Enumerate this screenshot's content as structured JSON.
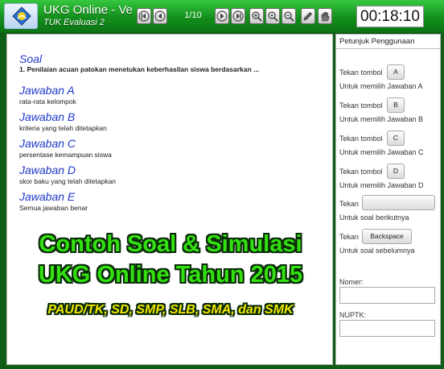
{
  "window": {
    "title": "UKG Online - Ver. (",
    "subtitle": "TUK Evaluasi 2",
    "page_indicator": "1/10",
    "timer": "00:18:10"
  },
  "toolbar": {
    "icons": [
      "first-page-icon",
      "prev-page-icon",
      "next-page-icon",
      "last-page-icon",
      "zoom-in-icon",
      "zoom-reset-icon",
      "zoom-out-icon",
      "edit-icon",
      "hand-icon"
    ]
  },
  "question": {
    "label": "Soal",
    "text": "1. Penilaian acuan patokan menetukan keberhasilan siswa berdasarkan ...",
    "answers": [
      {
        "label": "Jawaban A",
        "text": "rata-rata kelompok"
      },
      {
        "label": "Jawaban B",
        "text": "kriteria yang telah ditetapkan"
      },
      {
        "label": "Jawaban C",
        "text": "persentase kemampuan siswa"
      },
      {
        "label": "Jawaban D",
        "text": "skor baku yang telah ditetapkan"
      },
      {
        "label": "Jawaban E",
        "text": "Semua jawaban benar"
      }
    ]
  },
  "overlay": {
    "line1": "Contoh Soal & Simulasi",
    "line2": "UKG Online Tahun 2015",
    "line3": "PAUD/TK, SD, SMP, SLB, SMA, dan SMK"
  },
  "instructions": {
    "title": "Petunjuk Penggunaan",
    "press": "Tekan tombol",
    "press_short": "Tekan",
    "keys": [
      {
        "key": "A",
        "desc": "Untuk memilih Jawaban A"
      },
      {
        "key": "B",
        "desc": "Untuk memilih Jawaban B"
      },
      {
        "key": "C",
        "desc": "Untuk memilih Jawaban C"
      },
      {
        "key": "D",
        "desc": "Untuk memilih Jawaban D"
      }
    ],
    "next_key": "",
    "next_desc": "Untuk soal berikutnya",
    "prev_key": "Backspace",
    "prev_desc": "Untuk soal sebelumnya",
    "nomer_label": "Nomer:",
    "nomer_value": "",
    "nuptk_label": "NUPTK:",
    "nuptk_value": ""
  },
  "colors": {
    "titlebar": "#1a9e24",
    "answer_label": "#1f39c9",
    "overlay_green": "#33e010",
    "overlay_yellow": "#f2e600"
  }
}
